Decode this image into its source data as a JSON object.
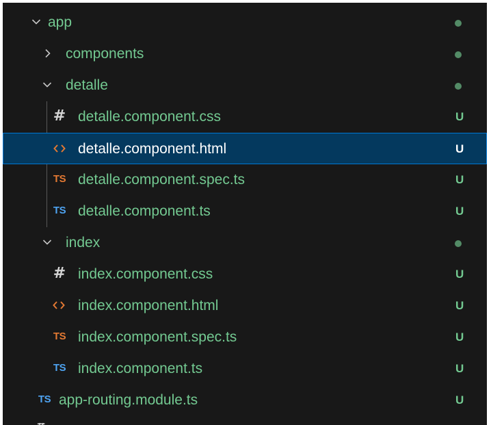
{
  "explorer": {
    "items": [
      {
        "kind": "folder",
        "expanded": true,
        "label": "app",
        "status_type": "dot",
        "depth": 0
      },
      {
        "kind": "folder",
        "expanded": false,
        "label": "components",
        "status_type": "dot",
        "depth": 1
      },
      {
        "kind": "folder",
        "expanded": true,
        "label": "detalle",
        "status_type": "dot",
        "depth": 1
      },
      {
        "kind": "file",
        "icon": "css-hash-icon",
        "icon_glyph": "#",
        "label": "detalle.component.css",
        "status": "U",
        "depth": 2
      },
      {
        "kind": "file",
        "icon": "html-angle-brackets-icon",
        "icon_glyph": "",
        "label": "detalle.component.html",
        "status": "U",
        "depth": 2,
        "selected": true
      },
      {
        "kind": "file",
        "icon": "typescript-spec-icon",
        "icon_glyph": "TS",
        "label": "detalle.component.spec.ts",
        "status": "U",
        "depth": 2
      },
      {
        "kind": "file",
        "icon": "typescript-icon",
        "icon_glyph": "TS",
        "label": "detalle.component.ts",
        "status": "U",
        "depth": 2
      },
      {
        "kind": "folder",
        "expanded": true,
        "label": "index",
        "status_type": "dot",
        "depth": 1
      },
      {
        "kind": "file",
        "icon": "css-hash-icon",
        "icon_glyph": "#",
        "label": "index.component.css",
        "status": "U",
        "depth": 2
      },
      {
        "kind": "file",
        "icon": "html-angle-brackets-icon",
        "icon_glyph": "",
        "label": "index.component.html",
        "status": "U",
        "depth": 2
      },
      {
        "kind": "file",
        "icon": "typescript-spec-icon",
        "icon_glyph": "TS",
        "label": "index.component.spec.ts",
        "status": "U",
        "depth": 2
      },
      {
        "kind": "file",
        "icon": "typescript-icon",
        "icon_glyph": "TS",
        "label": "index.component.ts",
        "status": "U",
        "depth": 2
      },
      {
        "kind": "file",
        "icon": "typescript-icon",
        "icon_glyph": "TS",
        "label": "app-routing.module.ts",
        "status": "U",
        "depth": 1
      }
    ],
    "partial_row_glyph": "#"
  },
  "colors": {
    "background": "#181818",
    "git_untracked": "#73c991",
    "selected_background": "#04395e",
    "selected_border": "#0078d4",
    "ts_blue": "#4ea3f1",
    "ts_orange": "#e37933",
    "html_orange": "#e37933"
  }
}
